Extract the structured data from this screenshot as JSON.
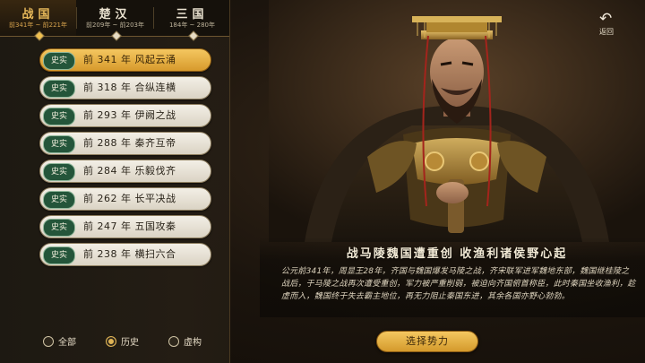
{
  "eras": [
    {
      "name": "战国",
      "range": "前341年 ~ 前221年",
      "active": true
    },
    {
      "name": "楚汉",
      "range": "前209年 ~ 前203年",
      "active": false
    },
    {
      "name": "三国",
      "range": "184年 ~ 280年",
      "active": false
    }
  ],
  "events": [
    {
      "tag": "史实",
      "label": "前 341 年  风起云涌",
      "selected": true
    },
    {
      "tag": "史实",
      "label": "前 318 年  合纵连横",
      "selected": false
    },
    {
      "tag": "史实",
      "label": "前 293 年  伊阙之战",
      "selected": false
    },
    {
      "tag": "史实",
      "label": "前 288 年  秦齐互帝",
      "selected": false
    },
    {
      "tag": "史实",
      "label": "前 284 年  乐毅伐齐",
      "selected": false
    },
    {
      "tag": "史实",
      "label": "前 262 年  长平决战",
      "selected": false
    },
    {
      "tag": "史实",
      "label": "前 247 年  五国攻秦",
      "selected": false
    },
    {
      "tag": "史实",
      "label": "前 238 年  横扫六合",
      "selected": false
    }
  ],
  "filters": [
    {
      "label": "全部",
      "checked": false
    },
    {
      "label": "历史",
      "checked": true
    },
    {
      "label": "虚构",
      "checked": false
    }
  ],
  "return_label": "返回",
  "return_icon": "return-arrow-icon",
  "description": {
    "title": "战马陵魏国遭重创   收渔利诸侯野心起",
    "body": "公元前341年，周显王28年，齐国与魏国爆发马陵之战，齐宋联军进军魏地东部，魏国继桂陵之战后，于马陵之战再次遭受重创，军力被严重削弱，被迫向齐国俯首称臣，此时秦国坐收渔利，趁虚而入，魏国终于失去霸主地位，再无力阻止秦国东进，其余各国亦野心勃勃。"
  },
  "select_button": "选择势力",
  "colors": {
    "accent": "#e8b95a",
    "tag_green": "#24553a",
    "panel": "#1d1912"
  }
}
